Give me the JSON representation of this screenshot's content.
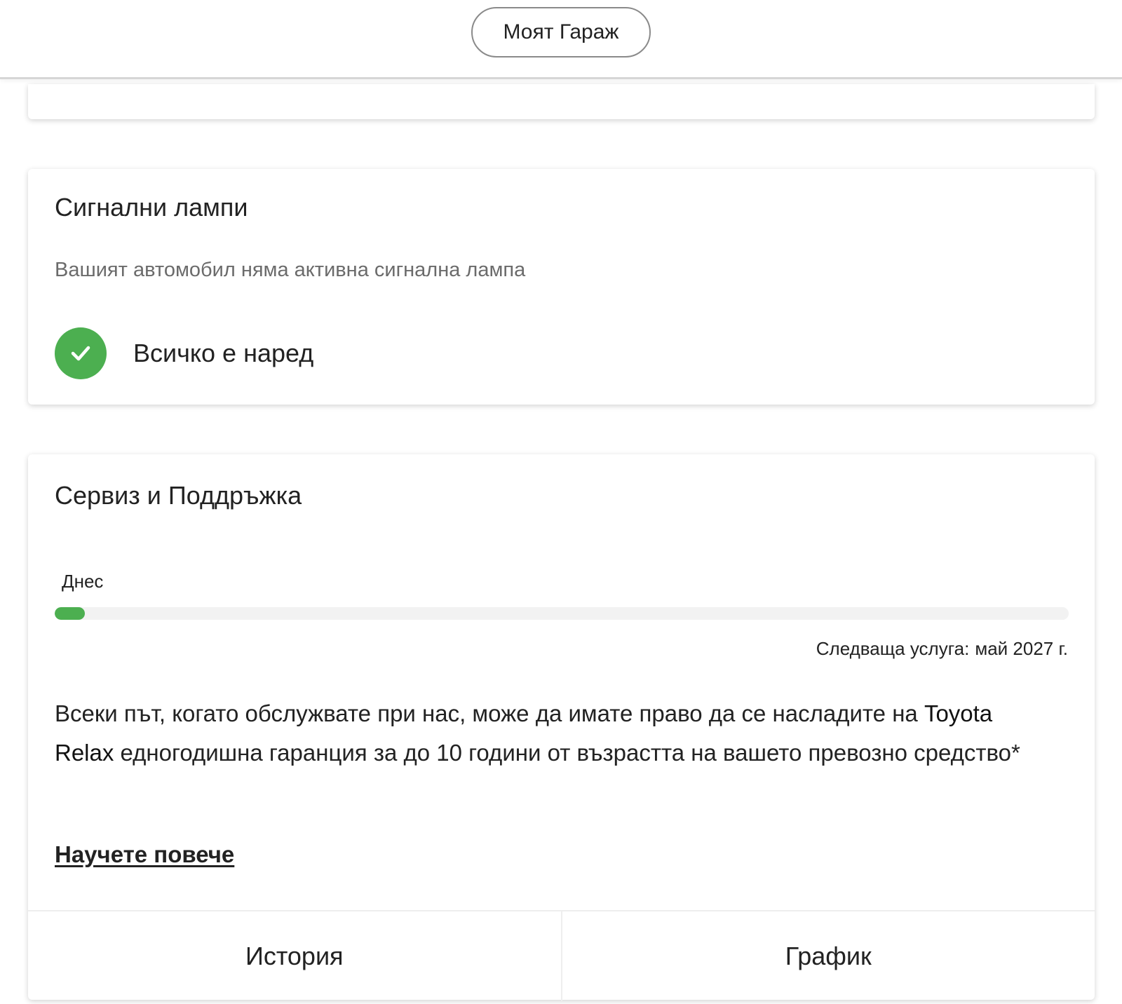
{
  "header": {
    "garage_button_label": "Моят Гараж"
  },
  "warning_lamps": {
    "title": "Сигнални лампи",
    "subtitle": "Вашият автомобил няма активна сигнална лампа",
    "status_icon": "check-circle-icon",
    "status_text": "Всичко е наред",
    "status_color": "#4caf50"
  },
  "service": {
    "title": "Сервиз и Поддръжка",
    "today_label": "Днес",
    "progress_fraction": 0.03,
    "progress_color": "#4caf50",
    "next_service_label": "Следваща услуга:",
    "next_service_date": "май 2027 г.",
    "relax_text_before": "Всеки път, когато обслужвате при нас, може да имате право да се насладите на ",
    "relax_brand": "Toyota Relax",
    "relax_text_after": " едногодишна гаранция за до 10 години от възрастта на вашето превозно средство*",
    "learn_more_label": "Научете повече",
    "tabs": [
      {
        "label": "История"
      },
      {
        "label": "График"
      }
    ]
  }
}
